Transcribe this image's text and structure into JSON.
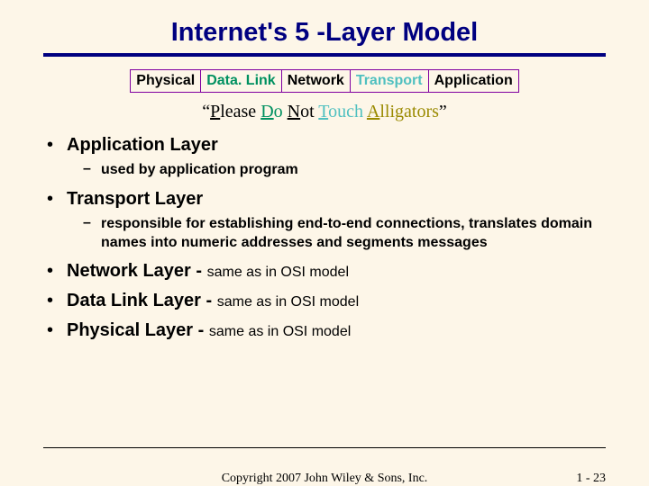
{
  "title": "Internet's 5 -Layer Model",
  "layers": {
    "physical": "Physical",
    "datalink": "Data. Link",
    "network": "Network",
    "transport": "Transport",
    "application": "Application"
  },
  "mnemonic": {
    "quote_open": "“",
    "p": "P",
    "p_rest": "lease ",
    "d": "D",
    "d_rest": "o ",
    "n": "N",
    "n_rest": "ot ",
    "t": "T",
    "t_rest": "ouch ",
    "a": "A",
    "a_rest": "lligators",
    "quote_close": "”"
  },
  "bullets": {
    "app": {
      "label": "Application Layer",
      "sub": "used by application program"
    },
    "transport": {
      "label": "Transport Layer",
      "sub": "responsible for establishing end-to-end connections, translates domain names into numeric addresses and segments messages"
    },
    "network": {
      "label": "Network Layer - ",
      "tail": "same as in OSI model"
    },
    "datalink": {
      "label": "Data Link Layer - ",
      "tail": "same as in OSI model"
    },
    "physical": {
      "label": "Physical Layer - ",
      "tail": "same as in OSI model"
    }
  },
  "footer": {
    "copyright": "Copyright 2007 John Wiley & Sons, Inc.",
    "page": "1  -  23"
  }
}
